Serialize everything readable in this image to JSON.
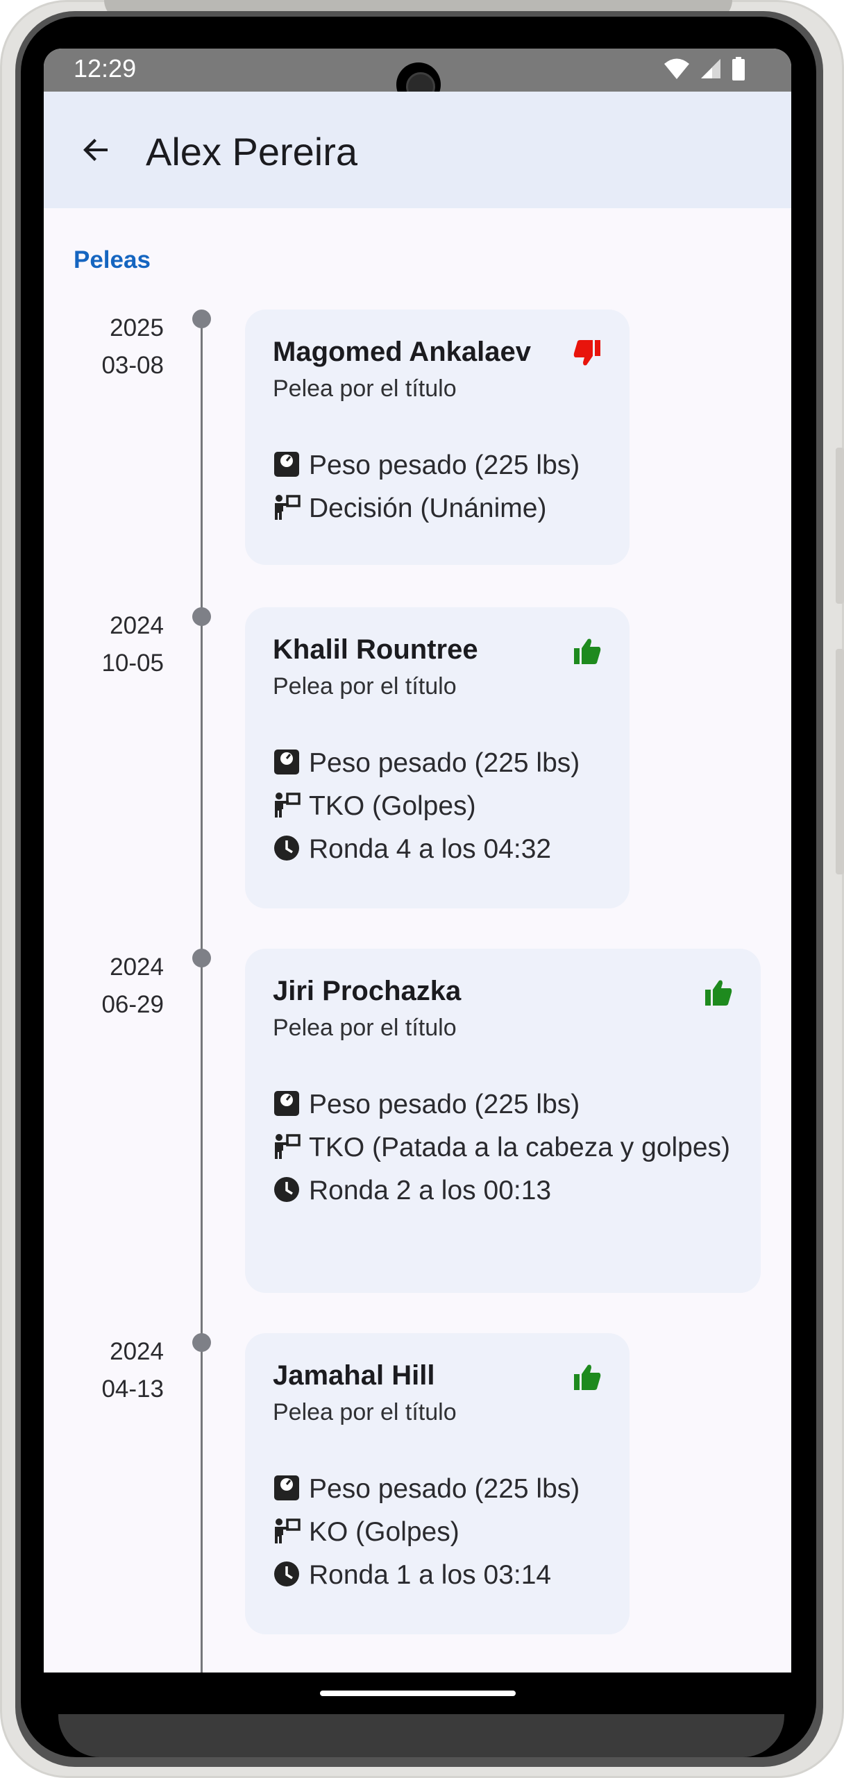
{
  "status_bar": {
    "time": "12:29"
  },
  "app_bar": {
    "title": "Alex Pereira"
  },
  "section": {
    "label": "Peleas"
  },
  "fights": [
    {
      "date_year": "2025",
      "date_md": "03-08",
      "opponent": "Magomed Ankalaev",
      "bout": "Pelea por el título",
      "result": "loss",
      "result_color": "#e8140c",
      "weight": "Peso pesado (225 lbs)",
      "method": "Decisión (Unánime)",
      "time": ""
    },
    {
      "date_year": "2024",
      "date_md": "10-05",
      "opponent": "Khalil Rountree",
      "bout": "Pelea por el título",
      "result": "win",
      "result_color": "#1e8a1e",
      "weight": "Peso pesado (225 lbs)",
      "method": "TKO (Golpes)",
      "time": "Ronda 4 a los 04:32"
    },
    {
      "date_year": "2024",
      "date_md": "06-29",
      "opponent": "Jiri Prochazka",
      "bout": "Pelea por el título",
      "result": "win",
      "result_color": "#1e8a1e",
      "weight": "Peso pesado (225 lbs)",
      "method": "TKO (Patada a la cabeza y golpes)",
      "time": "Ronda 2 a los 00:13"
    },
    {
      "date_year": "2024",
      "date_md": "04-13",
      "opponent": "Jamahal Hill",
      "bout": "Pelea por el título",
      "result": "win",
      "result_color": "#1e8a1e",
      "weight": "Peso pesado (225 lbs)",
      "method": "KO (Golpes)",
      "time": "Ronda 1 a los 03:14"
    }
  ],
  "icons": {
    "back": "arrow-back-icon",
    "weight": "scale-icon",
    "method": "referee-icon",
    "time": "clock-icon",
    "win": "thumb-up-icon",
    "loss": "thumb-down-icon"
  }
}
